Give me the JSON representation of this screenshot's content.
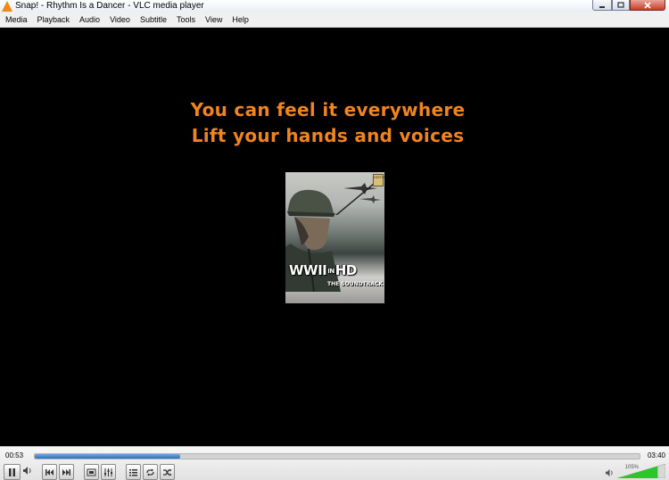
{
  "window": {
    "title": "Snap! - Rhythm Is a Dancer - VLC media player",
    "buttons": {
      "minimize": "minimize",
      "maximize": "maximize",
      "close": "close"
    }
  },
  "menu": [
    "Media",
    "Playback",
    "Audio",
    "Video",
    "Subtitle",
    "Tools",
    "View",
    "Help"
  ],
  "video": {
    "lyric_line_1": "You can feel it everywhere",
    "lyric_line_2": "Lift your hands and voices",
    "album_art": {
      "title": "WWII IN HD",
      "title_main": "WWII",
      "title_in": "IN",
      "title_hd": "HD",
      "subtitle": "THE SOUNDTRACK",
      "badge": "HISTORY"
    }
  },
  "playback": {
    "elapsed": "00:53",
    "total": "03:40",
    "progress_fraction": 0.24,
    "volume": "105%",
    "volume_fraction": 1.05
  },
  "colors": {
    "lyric": "#ef8420",
    "background": "#000000",
    "seek_fill": "#3a7bd5",
    "volume_fill": "#2ec42e"
  },
  "icons": [
    "vlc-cone-icon",
    "pause-icon",
    "mute-speaker-icon",
    "previous-icon",
    "next-icon",
    "fullscreen-icon",
    "extended-settings-icon",
    "playlist-icon",
    "loop-icon",
    "shuffle-icon",
    "volume-speaker-icon"
  ]
}
